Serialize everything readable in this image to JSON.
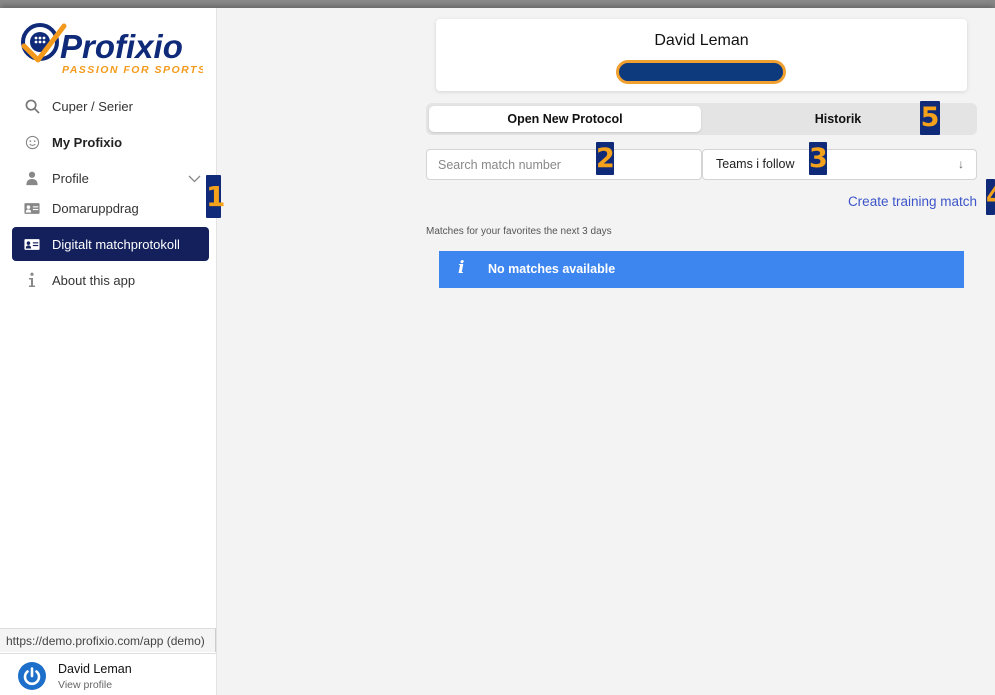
{
  "logo": {
    "brand": "Profixio",
    "tagline": "PASSION FOR SPORTS"
  },
  "sidebar": {
    "items": [
      {
        "label": "Cuper / Serier",
        "icon": "search-icon"
      },
      {
        "label": "My Profixio",
        "icon": "smiley-icon"
      },
      {
        "label": "Profile",
        "icon": "person-icon"
      },
      {
        "label": "Domaruppdrag",
        "icon": "id-card-icon"
      },
      {
        "label": "Digitalt matchprotokoll",
        "icon": "id-card-icon"
      },
      {
        "label": "About this app",
        "icon": "info-icon"
      }
    ],
    "url": "https://demo.profixio.com/app (demo)",
    "user": {
      "name": "David Leman",
      "sub": "View profile"
    }
  },
  "header": {
    "name": "David Leman"
  },
  "tabs": [
    {
      "label": "Open New Protocol"
    },
    {
      "label": "Historik"
    }
  ],
  "search": {
    "placeholder": "Search match number",
    "value": ""
  },
  "select": {
    "value": "Teams i follow"
  },
  "create_link": "Create training match",
  "section_label": "Matches for your favorites the next 3 days",
  "alert": {
    "icon": "i",
    "text": "No matches available"
  },
  "badges": [
    "1",
    "2",
    "3",
    "4",
    "5"
  ],
  "colors": {
    "accent": "#13205c",
    "badge_bg": "#0e2a78",
    "badge_fg": "#f4a11c",
    "alert_bg": "#3e86ef",
    "link": "#3d55c8"
  }
}
